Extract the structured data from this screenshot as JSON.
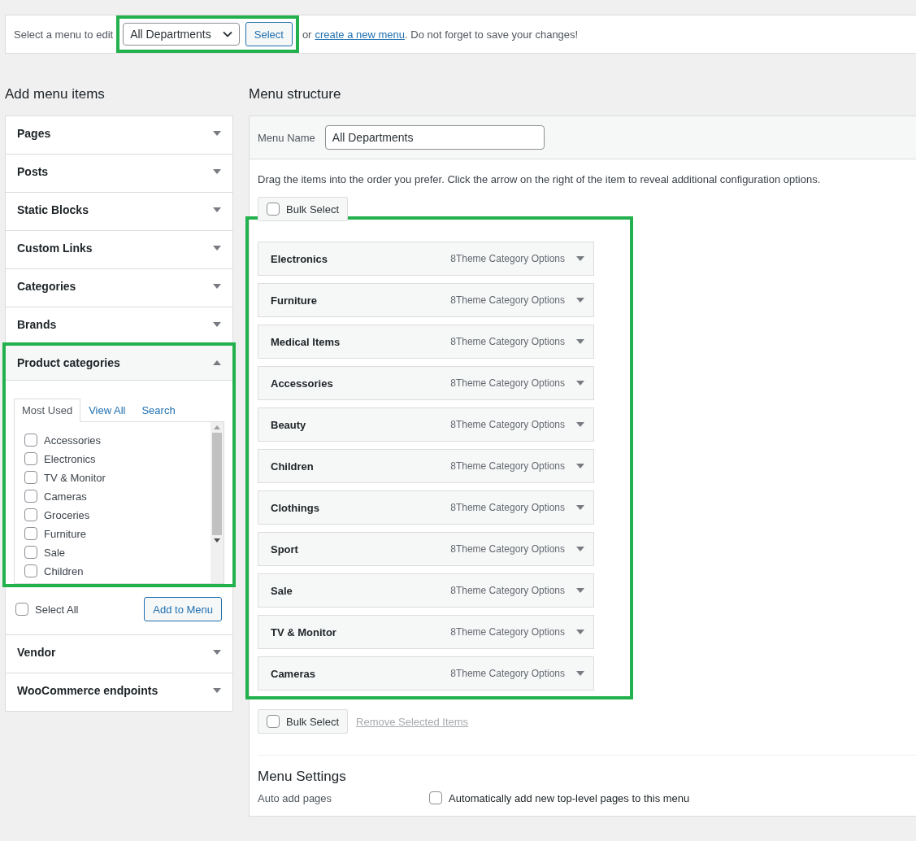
{
  "top_bar": {
    "highlighted": true,
    "prompt": "Select a menu to edit",
    "menu_select": {
      "value": "All Departments"
    },
    "select_button": "Select",
    "or_text": "or",
    "create_link": "create a new menu",
    "reminder": ". Do not forget to save your changes!"
  },
  "add_menu_items": {
    "heading": "Add menu items",
    "panels": [
      {
        "title": "Pages",
        "expanded": false,
        "highlighted": false
      },
      {
        "title": "Posts",
        "expanded": false,
        "highlighted": false
      },
      {
        "title": "Static Blocks",
        "expanded": false,
        "highlighted": false
      },
      {
        "title": "Custom Links",
        "expanded": false,
        "highlighted": false
      },
      {
        "title": "Categories",
        "expanded": false,
        "highlighted": false
      },
      {
        "title": "Brands",
        "expanded": false,
        "highlighted": false
      },
      {
        "title": "Product categories",
        "expanded": true,
        "highlighted": true,
        "tabs": [
          {
            "label": "Most Used",
            "selected": true
          },
          {
            "label": "View All",
            "selected": false
          },
          {
            "label": "Search",
            "selected": false
          }
        ],
        "items": [
          {
            "label": "Accessories",
            "checked": false
          },
          {
            "label": "Electronics",
            "checked": false
          },
          {
            "label": "TV & Monitor",
            "checked": false
          },
          {
            "label": "Cameras",
            "checked": false
          },
          {
            "label": "Groceries",
            "checked": false
          },
          {
            "label": "Furniture",
            "checked": false
          },
          {
            "label": "Sale",
            "checked": false
          },
          {
            "label": "Children",
            "checked": false
          }
        ],
        "select_all": {
          "label": "Select All",
          "checked": false
        },
        "add_button": "Add to Menu"
      },
      {
        "title": "Vendor",
        "expanded": false,
        "highlighted": false
      },
      {
        "title": "WooCommerce endpoints",
        "expanded": false,
        "highlighted": false
      }
    ]
  },
  "menu_structure": {
    "heading": "Menu structure",
    "menu_name_label": "Menu Name",
    "menu_name_value": "All Departments",
    "instructions": "Drag the items into the order you prefer. Click the arrow on the right of the item to reveal additional configuration options.",
    "bulk_select_top": {
      "label": "Bulk Select",
      "checked": false
    },
    "items_highlighted": true,
    "items": [
      {
        "title": "Electronics",
        "type_label": "8Theme Category Options"
      },
      {
        "title": "Furniture",
        "type_label": "8Theme Category Options"
      },
      {
        "title": "Medical Items",
        "type_label": "8Theme Category Options"
      },
      {
        "title": "Accessories",
        "type_label": "8Theme Category Options"
      },
      {
        "title": "Beauty",
        "type_label": "8Theme Category Options"
      },
      {
        "title": "Children",
        "type_label": "8Theme Category Options"
      },
      {
        "title": "Clothings",
        "type_label": "8Theme Category Options"
      },
      {
        "title": "Sport",
        "type_label": "8Theme Category Options"
      },
      {
        "title": "Sale",
        "type_label": "8Theme Category Options"
      },
      {
        "title": "TV & Monitor",
        "type_label": "8Theme Category Options"
      },
      {
        "title": "Cameras",
        "type_label": "8Theme Category Options"
      }
    ],
    "bulk_select_bottom": {
      "label": "Bulk Select",
      "checked": false
    },
    "remove_link": {
      "label": "Remove Selected Items",
      "disabled": true
    },
    "settings": {
      "heading": "Menu Settings",
      "auto_add_label": "Auto add pages",
      "auto_add_option": {
        "label": "Automatically add new top-level pages to this menu",
        "checked": false
      }
    }
  }
}
